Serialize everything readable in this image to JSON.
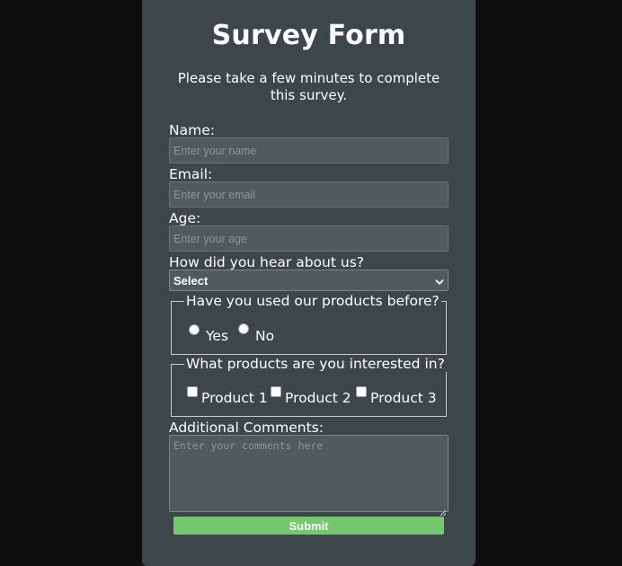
{
  "form": {
    "title": "Survey Form",
    "subtitle": "Please take a few minutes to complete this survey.",
    "name": {
      "label": "Name:",
      "placeholder": "Enter your name",
      "value": ""
    },
    "email": {
      "label": "Email:",
      "placeholder": "Enter your email",
      "value": ""
    },
    "age": {
      "label": "Age:",
      "placeholder": "Enter your age",
      "value": ""
    },
    "source": {
      "label": "How did you hear about us?",
      "selected": "Select"
    },
    "used_before": {
      "legend": "Have you used our products before?",
      "options": [
        {
          "label": "Yes",
          "checked": false
        },
        {
          "label": "No",
          "checked": false
        }
      ]
    },
    "interests": {
      "legend": "What products are you interested in?",
      "options": [
        {
          "label": "Product 1",
          "checked": false
        },
        {
          "label": "Product 2",
          "checked": false
        },
        {
          "label": "Product 3",
          "checked": false
        }
      ]
    },
    "comments": {
      "label": "Additional Comments:",
      "placeholder": "Enter your comments here",
      "value": ""
    },
    "submit_label": "Submit"
  },
  "colors": {
    "page_background": "#0e0e0e",
    "card_background": "#3d4648",
    "input_background": "#525b5c",
    "submit_button": "#74c76c",
    "text": "#ffffff"
  },
  "icons": {
    "select_arrow": "chevron-down-icon",
    "textarea_resize": "resize-grip-icon"
  }
}
